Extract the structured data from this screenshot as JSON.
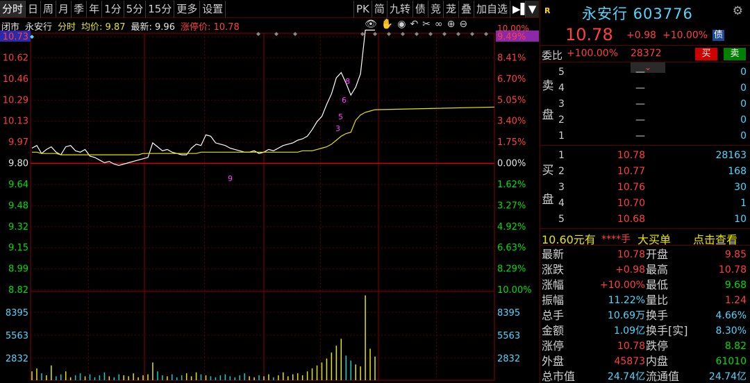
{
  "toolbar": {
    "left": [
      "分时",
      "日",
      "周",
      "月",
      "季",
      "年",
      "1分",
      "5分",
      "15分",
      "更多",
      "设置"
    ],
    "right": [
      "PK",
      "简",
      "九转",
      "债",
      "竞",
      "茏",
      "叠",
      "加自选"
    ],
    "play_icon": "▶▌",
    "dropdown_icon": "▼"
  },
  "info": {
    "status": "闭市",
    "name": "永安行",
    "mode": "分时",
    "avg_label": "均价: 9.87",
    "last_label": "最新: 9.96",
    "limit_label": "涨停价: 10.78"
  },
  "tools": [
    "👁",
    "✋",
    "◉",
    "↶",
    "✂",
    "∞",
    "⊕",
    "⊖"
  ],
  "chart_data": {
    "type": "line",
    "prev_close": 9.8,
    "price_ticks": [
      "10.73",
      "10.62",
      "10.46",
      "10.29",
      "10.13",
      "9.97",
      "9.80",
      "9.64",
      "9.48",
      "9.32",
      "9.15",
      "8.99",
      "8.82"
    ],
    "pct_ticks": [
      "9.49%",
      "8.41%",
      "6.70%",
      "5.05%",
      "3.40%",
      "1.75%",
      "0.00%",
      "1.62%",
      "3.27%",
      "4.92%",
      "6.63%",
      "8.29%",
      "10.00%"
    ],
    "top_pct_label": "10.00%",
    "volume_ticks": [
      "8395",
      "5563",
      "2832"
    ],
    "price": [
      9.89,
      9.91,
      9.85,
      9.88,
      9.9,
      9.86,
      9.84,
      9.9,
      9.91,
      9.87,
      9.86,
      9.88,
      9.83,
      9.82,
      9.8,
      9.78,
      9.79,
      9.77,
      9.76,
      9.77,
      9.78,
      9.79,
      9.8,
      9.81,
      9.82,
      9.93,
      9.9,
      9.87,
      9.88,
      9.86,
      9.85,
      9.84,
      9.84,
      9.89,
      9.92,
      9.91,
      9.99,
      9.98,
      9.93,
      9.92,
      9.91,
      9.89,
      9.88,
      9.87,
      9.86,
      9.86,
      9.87,
      9.85,
      9.86,
      9.88,
      9.87,
      9.89,
      9.91,
      9.92,
      9.93,
      9.95,
      9.96,
      9.98,
      10.03,
      10.09,
      10.13,
      10.22,
      10.3,
      10.42,
      10.46,
      10.38,
      10.29,
      10.35,
      10.45,
      10.78,
      10.78,
      10.78
    ],
    "avg": [
      9.86,
      9.86,
      9.85,
      9.85,
      9.85,
      9.85,
      9.84,
      9.84,
      9.84,
      9.84,
      9.84,
      9.84,
      9.84,
      9.84,
      9.84,
      9.84,
      9.84,
      9.84,
      9.84,
      9.84,
      9.84,
      9.84,
      9.84,
      9.85,
      9.85,
      9.85,
      9.85,
      9.85,
      9.85,
      9.85,
      9.85,
      9.85,
      9.85,
      9.85,
      9.85,
      9.86,
      9.86,
      9.86,
      9.86,
      9.86,
      9.86,
      9.86,
      9.86,
      9.86,
      9.86,
      9.86,
      9.86,
      9.86,
      9.86,
      9.86,
      9.86,
      9.86,
      9.86,
      9.86,
      9.86,
      9.86,
      9.87,
      9.87,
      9.87,
      9.88,
      9.89,
      9.9,
      9.92,
      9.95,
      9.98,
      10.0,
      10.01,
      10.1,
      10.14,
      10.16,
      10.17,
      10.18
    ],
    "volume": [
      900,
      1200,
      700,
      500,
      1500,
      400,
      600,
      900,
      300,
      500,
      700,
      400,
      600,
      300,
      500,
      800,
      400,
      300,
      600,
      500,
      400,
      700,
      300,
      500,
      600,
      1800,
      900,
      500,
      400,
      600,
      300,
      500,
      700,
      400,
      800,
      600,
      500,
      400,
      300,
      500,
      600,
      400,
      300,
      500,
      700,
      400,
      300,
      500,
      400,
      600,
      300,
      500,
      800,
      400,
      600,
      700,
      500,
      900,
      1200,
      1500,
      1800,
      2200,
      2800,
      3500,
      4200,
      2500,
      2000,
      1600,
      1400,
      8600,
      3200,
      2400
    ],
    "markers": [
      {
        "label": "8",
        "color": "#ff40ff"
      },
      {
        "label": "6",
        "color": "#ff40ff"
      },
      {
        "label": "5",
        "color": "#ff40ff"
      },
      {
        "label": "3",
        "color": "#ff40ff"
      },
      {
        "label": "9",
        "color": "#ff40ff"
      }
    ]
  },
  "panel": {
    "r_badge": "R",
    "title": "永安行 603776",
    "price": "10.78",
    "change": "+0.98",
    "change_pct": "+10.00%",
    "bond_badge": "债",
    "weibi_label": "委比",
    "weibi_pct": "+100.00%",
    "weibi_diff": "28372",
    "buy_button": "买",
    "sell_button": "卖",
    "sell_side_label": [
      "卖",
      "盘"
    ],
    "buy_side_label": [
      "买",
      "盘"
    ],
    "caret": "⌄",
    "asks": [
      {
        "level": "5",
        "price": "—",
        "qty": "0"
      },
      {
        "level": "4",
        "price": "—",
        "qty": "0"
      },
      {
        "level": "3",
        "price": "—",
        "qty": "0"
      },
      {
        "level": "2",
        "price": "—",
        "qty": "0"
      },
      {
        "level": "1",
        "price": "—",
        "qty": "0"
      }
    ],
    "bids": [
      {
        "level": "1",
        "price": "10.78",
        "qty": "28163"
      },
      {
        "level": "2",
        "price": "10.77",
        "qty": "168"
      },
      {
        "level": "3",
        "price": "10.76",
        "qty": "30"
      },
      {
        "level": "4",
        "price": "10.70",
        "qty": "1"
      },
      {
        "level": "5",
        "price": "10.68",
        "qty": "10"
      }
    ],
    "bigorder": {
      "price": "10.60元有",
      "qty": "****手",
      "label": "大买单",
      "link": "点击查看"
    },
    "stats": [
      {
        "l1": "最新",
        "v1": "10.78",
        "c1": "red",
        "l2": "开盘",
        "v2": "9.85",
        "c2": "red"
      },
      {
        "l1": "涨跌",
        "v1": "+0.98",
        "c1": "red",
        "l2": "最高",
        "v2": "10.78",
        "c2": "red"
      },
      {
        "l1": "涨幅",
        "v1": "+10.00%",
        "c1": "red",
        "l2": "最低",
        "v2": "9.68",
        "c2": "green"
      },
      {
        "l1": "振幅",
        "v1": "11.22%",
        "c1": "cyan",
        "l2": "量比",
        "v2": "1.24",
        "c2": "red"
      },
      {
        "l1": "总手",
        "v1": "10.69万",
        "c1": "cyan",
        "l2": "换手",
        "v2": "4.66%",
        "c2": "cyan"
      },
      {
        "l1": "金额",
        "v1": "1.09亿",
        "c1": "cyan",
        "l2": "换手[实]",
        "v2": "8.30%",
        "c2": "cyan"
      },
      {
        "l1": "涨停",
        "v1": "10.78",
        "c1": "red",
        "l2": "跌停",
        "v2": "8.82",
        "c2": "green"
      },
      {
        "l1": "外盘",
        "v1": "45873",
        "c1": "red",
        "l2": "内盘",
        "v2": "61010",
        "c2": "green"
      },
      {
        "l1": "总市值",
        "v1": "24.74亿",
        "c1": "cyan",
        "l2": "流通值",
        "v2": "24.74亿",
        "c2": "cyan"
      }
    ]
  }
}
